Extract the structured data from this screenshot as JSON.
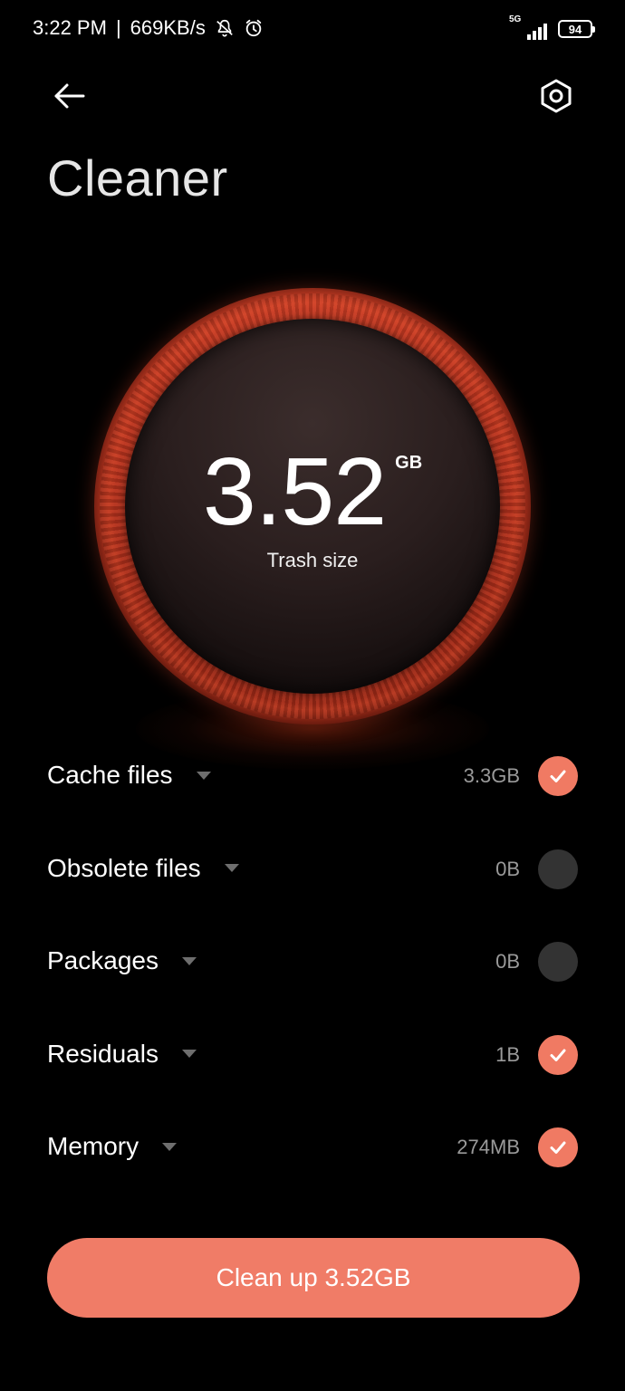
{
  "status_bar": {
    "time": "3:22 PM",
    "separator": "|",
    "speed": "669KB/s",
    "network": "5G",
    "battery": "94",
    "icons": [
      "mute-icon",
      "alarm-icon",
      "signal-icon",
      "battery-icon"
    ]
  },
  "header": {
    "title": "Cleaner",
    "back_icon": "arrow-left-icon",
    "settings_icon": "settings-hexagon-icon"
  },
  "gauge": {
    "value": "3.52",
    "unit": "GB",
    "label": "Trash size"
  },
  "categories": [
    {
      "name": "Cache files",
      "size": "3.3GB",
      "checked": true
    },
    {
      "name": "Obsolete files",
      "size": "0B",
      "checked": false
    },
    {
      "name": "Packages",
      "size": "0B",
      "checked": false
    },
    {
      "name": "Residuals",
      "size": "1B",
      "checked": true
    },
    {
      "name": "Memory",
      "size": "274MB",
      "checked": true
    }
  ],
  "action": {
    "label": "Clean up 3.52GB"
  },
  "colors": {
    "background": "#000000",
    "accent": "#f07c67",
    "unchecked": "#333333",
    "ring": "#c23a24",
    "muted_text": "#9a9a9a"
  }
}
